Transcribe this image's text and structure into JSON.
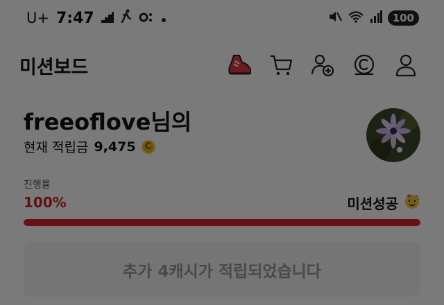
{
  "status_bar": {
    "carrier": "U+",
    "time": "7:47",
    "battery": "100"
  },
  "header": {
    "title": "미션보드",
    "icons": [
      "sneaker-icon",
      "cart-icon",
      "add-friend-icon",
      "cash-coin-icon",
      "user-profile-icon"
    ]
  },
  "profile": {
    "username": "freeoflove님의",
    "points_label": "현재 적립금",
    "points_value": "9,475",
    "coin_symbol": "C"
  },
  "progress": {
    "label": "진행률",
    "percent_text": "100%",
    "fraction": 1.0,
    "status": "미션성공",
    "status_emoji": "🥳",
    "accent_color": "#d9252d"
  },
  "notice": {
    "text": "추가 4캐시가 적립되었습니다"
  }
}
